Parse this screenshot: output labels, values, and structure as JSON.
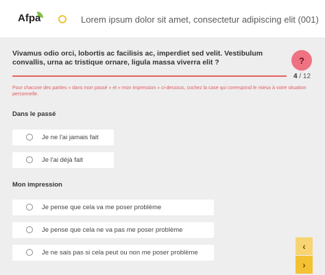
{
  "header": {
    "logo_text": "Afpa",
    "title": "Lorem ipsum dolor sit amet, consectetur adipiscing elit (001)"
  },
  "question": {
    "text": "Vivamus odio orci, lobortis ac facilisis ac, imperdiet sed velit. Vestibulum convallis, urna ac tristique ornare, ligula massa viverra elit ?",
    "help_label": "?",
    "progress_current": "4",
    "progress_separator": " / ",
    "progress_total": "12",
    "instruction": "Pour chacune des parties « dans mon passé » et « mon impression » ci-dessous, cochez la case qui correspond le mieux à votre situation personnelle."
  },
  "sections": [
    {
      "title": "Dans le passé",
      "options": [
        "Je ne l'ai jamais fait",
        "Je l'ai déjà fait"
      ]
    },
    {
      "title": "Mon impression",
      "options": [
        "Je pense que cela va me poser problème",
        "Je pense que cela ne va pas me poser problème",
        "Je ne sais pas si cela peut ou non me poser problème"
      ]
    }
  ],
  "nav": {
    "prev_symbol": "‹",
    "next_symbol": "›"
  },
  "colors": {
    "accent_red": "#e2615f",
    "help_pink": "#ef7282",
    "nav_yellow": "#f3c233",
    "logo_green": "#7dc142"
  }
}
